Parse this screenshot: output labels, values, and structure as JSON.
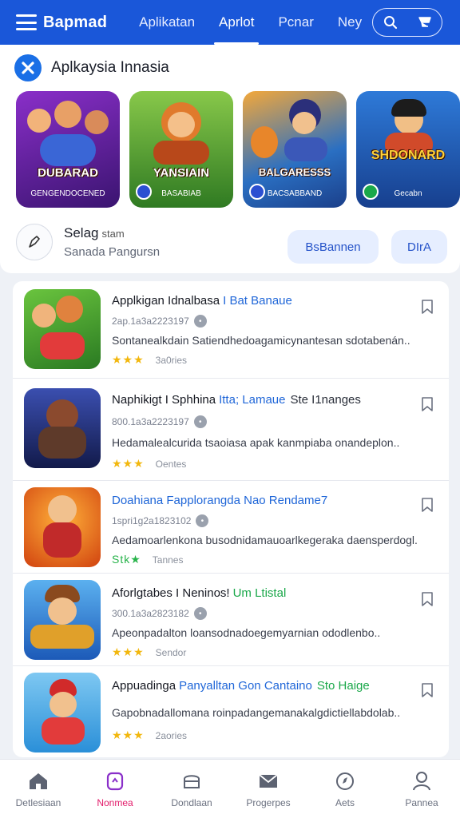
{
  "header": {
    "brand": "Bapmad",
    "tabs": [
      {
        "label": "Aplikatan"
      },
      {
        "label": "Aprlot"
      },
      {
        "label": "Pcnar"
      },
      {
        "label": "Ney"
      }
    ],
    "active_tab": 1,
    "accent": "#1a57d9"
  },
  "featured": {
    "title": "Aplkaysia Innasia",
    "tiles": [
      {
        "label": "DUBARAD",
        "sub": "GENGENDOCENED",
        "bg": "#5b2a9a"
      },
      {
        "label": "YANSIAIN",
        "sub": "BASABIAB",
        "bg": "#3c8e2a"
      },
      {
        "label": "BALGARESSS",
        "sub": "BACSABBAND",
        "bg": "#2a7fb8"
      },
      {
        "label": "SHDONARD",
        "sub": "Gecabn",
        "bg": "#1f5fb0"
      }
    ]
  },
  "sort": {
    "title": "Selag",
    "title_small": "stam",
    "subtitle": "Sanada Pangursn",
    "button_primary": "BsBannen",
    "button_secondary": "DIrA"
  },
  "list": [
    {
      "title": "Applkigan Idnalbasa",
      "accent": "I Bat Banaue",
      "accent_color": "#1f66d8",
      "tail": "",
      "meta": "2ap.1a3a2223197",
      "desc": "Sontanealkdain Satiendhedoagamicynantesan sdotabenán..",
      "stars": "★★★",
      "stars_color": "yellow",
      "rating_text": "3a0ries",
      "thumb_bg": "#5aa83a"
    },
    {
      "title": "Naphikigt I Sphhina",
      "accent": "Itta; Lamaue",
      "accent_color": "#1f66d8",
      "tail": "Ste I1nanges",
      "meta": "800.1a3a2223197",
      "desc": "Hedamalealcurida tsaoiasa apak kanmpiaba onandeplon..",
      "stars": "★★★",
      "stars_color": "yellow",
      "rating_text": "Oentes",
      "thumb_bg": "#2b3d8f"
    },
    {
      "title": "",
      "accent": "Doahiana Fapplorangda Nao Rendame7",
      "accent_color": "#1f66d8",
      "tail": "",
      "meta": "1spri1g2a1823102",
      "desc": "Aedamoarlenkona busodnidamauoarlkegeraka daensperdogl.",
      "stars": "Stk★",
      "stars_color": "green",
      "rating_text": "Tannes",
      "thumb_bg": "#e0671f"
    },
    {
      "title": "Aforlgtabes I Neninos!",
      "accent": "Um Ltistal",
      "accent_color": "#1aa84a",
      "tail": "",
      "meta": "300.1a3a2823182",
      "desc": "Apeonpadalton loansodnadoegemyarnian ododlenbo..",
      "stars": "★★★",
      "stars_color": "yellow",
      "rating_text": "Sendor",
      "thumb_bg": "#3a78c8"
    },
    {
      "title": "Appuadinga",
      "accent": "Panyalltan Gon Cantaino",
      "accent_color": "#1f66d8",
      "tail": "Sto Haige",
      "meta": "",
      "desc": "Gapobnadallomana roinpadangemanakalgdictiellabdolab..",
      "stars": "★★★",
      "stars_color": "yellow",
      "rating_text": "2aories",
      "thumb_bg": "#3ea0df"
    }
  ],
  "bottom_nav": [
    {
      "label": "Detlesiaan",
      "icon": "home-icon"
    },
    {
      "label": "Nonmea",
      "icon": "games-icon"
    },
    {
      "label": "Dondlaan",
      "icon": "store-icon"
    },
    {
      "label": "Progerpes",
      "icon": "envelope-icon"
    },
    {
      "label": "Aets",
      "icon": "compass-icon"
    },
    {
      "label": "Pannea",
      "icon": "person-icon"
    }
  ],
  "bottom_nav_active": 1
}
